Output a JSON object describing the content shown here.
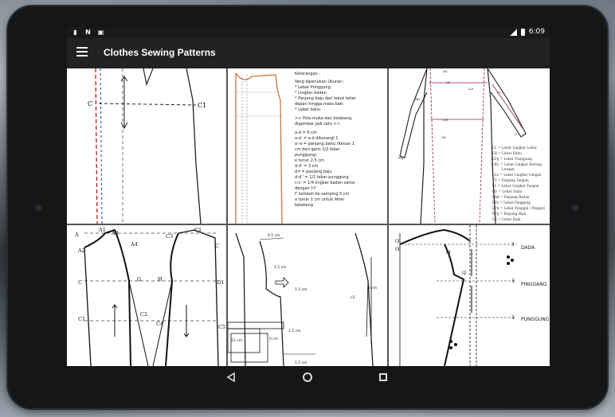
{
  "status": {
    "left_icons": [
      "N"
    ],
    "time": "6:09"
  },
  "appbar": {
    "title": "Clothes Sewing Patterns"
  },
  "tiles": {
    "t1": {
      "labels": [
        "C",
        "C1"
      ]
    },
    "t2": {
      "notes": [
        "Keterangan :",
        "Yang diperlukan Ukuran :",
        "* Lebar Punggung",
        "* Lingkar badan",
        "* Panjang baju dari lekuk leher",
        "depan hingga mata kaki",
        "* Lebar bahu",
        ">> Pola muka dan belakang",
        "digambar jadi satu <<",
        "a-d = 6 cm",
        "a-a' = a-d dikurangi 1",
        "a'-e = panjang bahu (Keluar 1",
        "cm dari garis 1/2 lebar",
        "punggung)",
        "e turun 2.5 cm",
        "d-d' = 3 cm",
        "d-f = panjang baju",
        "d-d'' = 1/2 lebar punggung",
        "c-c' = 1/4 lingkar badan sama",
        "dengan f-f'",
        "f' tambah ke samping 5 cm",
        "a turun 1 cm untuk leher",
        "belakang"
      ]
    },
    "t3": {
      "legend": [
        "LL = Lebar Lingkar Leher",
        "LB = Lebar Bahu",
        "LPg = Lebar Punggung",
        "LKL = Lebar Lingkar Kerung",
        "Lengan",
        "LLe = Lebar Lingkar Lengan",
        "PT = Panjang Tangan",
        "LT = Lebar Lingkar Tangan",
        "LD = Lebar Dada",
        "PBd = Panjang Badan",
        "LPa = Lebar Pinggang",
        "LPn = Lebar Panggul / Pinggul",
        "PPg = Panjang Baju",
        "LK = Lebar Kaki"
      ],
      "marks": [
        "LKL",
        "LD",
        "LLe",
        "PBd",
        "LPa",
        "LPn",
        "PT",
        "LT",
        "PPg"
      ]
    },
    "t4": {
      "labels": [
        "A",
        "A1",
        "A2",
        "A3",
        "A4",
        "C3",
        "C1",
        "C",
        "C",
        "G",
        "H",
        "D1",
        "C1",
        "C2",
        "C4",
        "C5"
      ]
    },
    "t5": {
      "labels": [
        "0.5 cm",
        "1.5 cm",
        "1.3 cm",
        "L5",
        "2 cm",
        "1.5 cm",
        "11 cm",
        "4 cm",
        "1.5 cm"
      ]
    },
    "t6": {
      "labels": [
        "DADA",
        "PINGGANG",
        "PUNGGUNG",
        "3",
        "3",
        "3",
        "I3",
        "I3",
        "I4",
        "I2"
      ]
    }
  }
}
